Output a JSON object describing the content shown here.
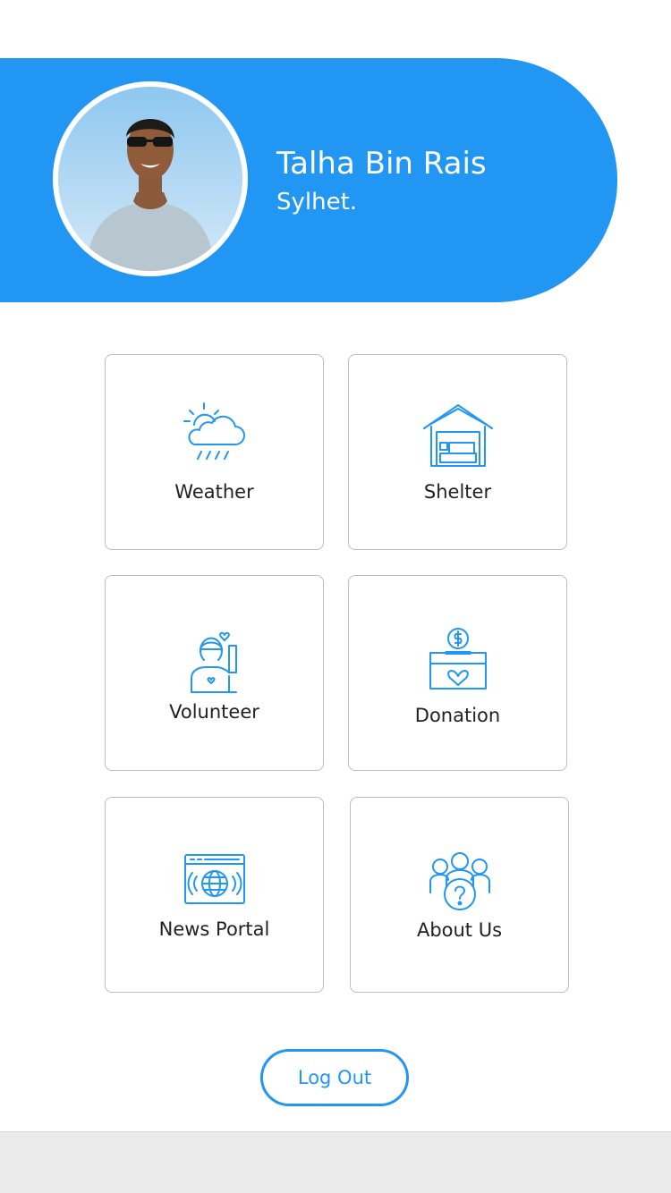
{
  "profile": {
    "name": "Talha Bin Rais",
    "location": "Sylhet.",
    "avatar_icon": "profile-photo"
  },
  "menu": {
    "items": [
      {
        "label": "Weather",
        "icon": "weather-icon"
      },
      {
        "label": "Shelter",
        "icon": "shelter-icon"
      },
      {
        "label": "Volunteer",
        "icon": "volunteer-icon"
      },
      {
        "label": "Donation",
        "icon": "donation-icon"
      },
      {
        "label": "News Portal",
        "icon": "news-portal-icon"
      },
      {
        "label": "About Us",
        "icon": "about-us-icon"
      }
    ]
  },
  "logout": {
    "label": "Log Out"
  },
  "colors": {
    "accent": "#2196f3",
    "text": "#212121",
    "card_border": "#bdbdbd",
    "bottom_bar": "#ebebeb"
  }
}
